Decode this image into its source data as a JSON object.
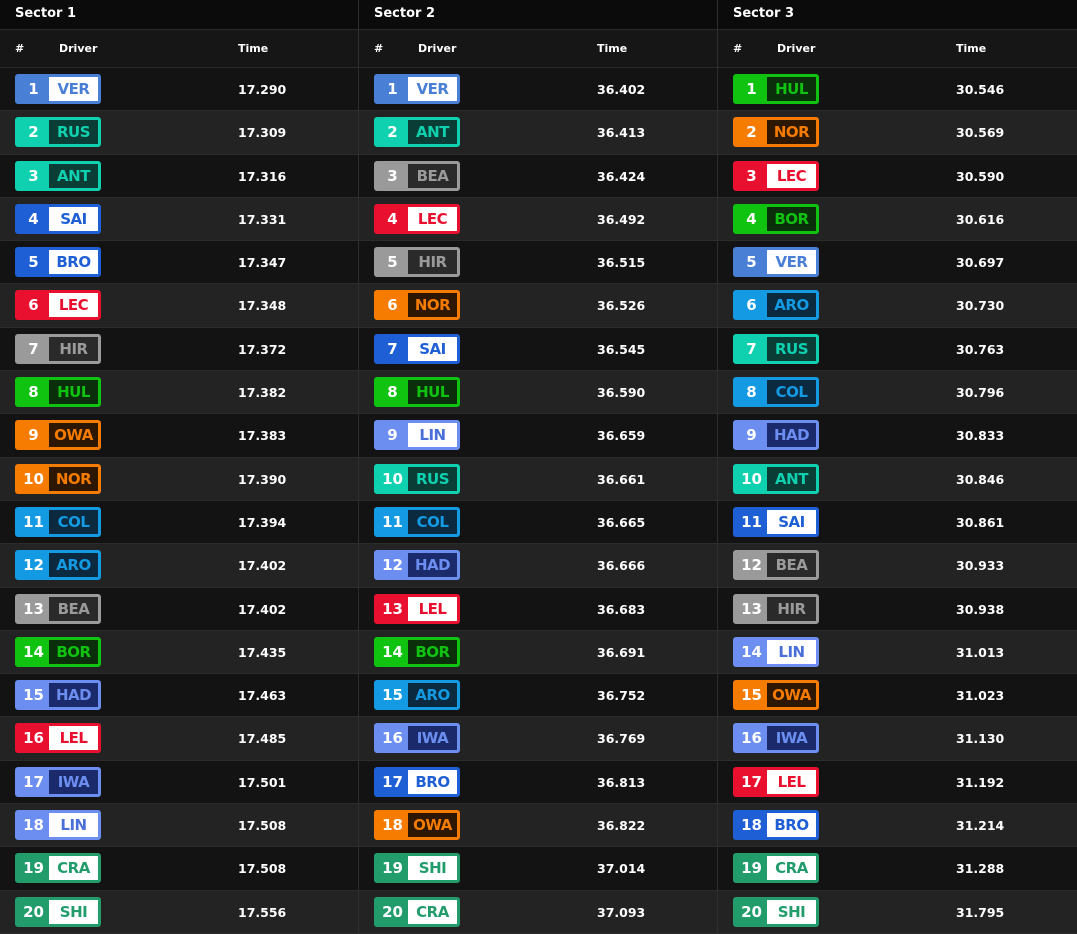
{
  "headers": {
    "num": "#",
    "driver": "Driver",
    "time": "Time"
  },
  "teams": {
    "VER": {
      "bg": "#4a7fd6",
      "inner": "#ffffff",
      "text": "#4a7fd6"
    },
    "HAD": {
      "bg": "#6b8ef0",
      "inner": "#1b2a6b",
      "text": "#6b8ef0"
    },
    "LIN": {
      "bg": "#6b8ef0",
      "inner": "#ffffff",
      "text": "#4a6fd8"
    },
    "IWA": {
      "bg": "#6b8ef0",
      "inner": "#1b2a6b",
      "text": "#6b8ef0"
    },
    "RUS": {
      "bg": "#0fd1b0",
      "inner": "#0a3d35",
      "text": "#0fd1b0"
    },
    "ANT": {
      "bg": "#0fd1b0",
      "inner": "#0a3d35",
      "text": "#0fd1b0"
    },
    "SAI": {
      "bg": "#1e5fd6",
      "inner": "#ffffff",
      "text": "#1e5fd6"
    },
    "ALB": {
      "bg": "#1e5fd6",
      "inner": "#ffffff",
      "text": "#1e5fd6"
    },
    "BRO": {
      "bg": "#1e5fd6",
      "inner": "#ffffff",
      "text": "#1e5fd6"
    },
    "LEC": {
      "bg": "#e8102e",
      "inner": "#ffffff",
      "text": "#e8102e"
    },
    "LEL": {
      "bg": "#e8102e",
      "inner": "#ffffff",
      "text": "#e8102e"
    },
    "HIR": {
      "bg": "#9a9a9a",
      "inner": "#2a2a2a",
      "text": "#9a9a9a"
    },
    "BEA": {
      "bg": "#9a9a9a",
      "inner": "#2a2a2a",
      "text": "#9a9a9a"
    },
    "HUL": {
      "bg": "#11c311",
      "inner": "#0b2e0b",
      "text": "#11c311"
    },
    "BOR": {
      "bg": "#11c311",
      "inner": "#0b2e0b",
      "text": "#11c311"
    },
    "NOR": {
      "bg": "#f57c00",
      "inner": "#2e1700",
      "text": "#f57c00"
    },
    "OWA": {
      "bg": "#f57c00",
      "inner": "#2e1700",
      "text": "#f57c00"
    },
    "COL": {
      "bg": "#149ae3",
      "inner": "#0b2a40",
      "text": "#149ae3"
    },
    "ARO": {
      "bg": "#149ae3",
      "inner": "#0b2a40",
      "text": "#149ae3"
    },
    "CRA": {
      "bg": "#239c6c",
      "inner": "#ffffff",
      "text": "#239c6c"
    },
    "SHI": {
      "bg": "#239c6c",
      "inner": "#ffffff",
      "text": "#239c6c"
    }
  },
  "sectors": [
    {
      "title": "Sector 1",
      "rows": [
        {
          "pos": "1",
          "code": "VER",
          "time": "17.290"
        },
        {
          "pos": "2",
          "code": "RUS",
          "time": "17.309"
        },
        {
          "pos": "3",
          "code": "ANT",
          "time": "17.316"
        },
        {
          "pos": "4",
          "code": "SAI",
          "time": "17.331"
        },
        {
          "pos": "5",
          "code": "BRO",
          "time": "17.347"
        },
        {
          "pos": "6",
          "code": "LEC",
          "time": "17.348"
        },
        {
          "pos": "7",
          "code": "HIR",
          "time": "17.372"
        },
        {
          "pos": "8",
          "code": "HUL",
          "time": "17.382"
        },
        {
          "pos": "9",
          "code": "OWA",
          "time": "17.383"
        },
        {
          "pos": "10",
          "code": "NOR",
          "time": "17.390"
        },
        {
          "pos": "11",
          "code": "COL",
          "time": "17.394"
        },
        {
          "pos": "12",
          "code": "ARO",
          "time": "17.402"
        },
        {
          "pos": "13",
          "code": "BEA",
          "time": "17.402"
        },
        {
          "pos": "14",
          "code": "BOR",
          "time": "17.435"
        },
        {
          "pos": "15",
          "code": "HAD",
          "time": "17.463"
        },
        {
          "pos": "16",
          "code": "LEL",
          "time": "17.485"
        },
        {
          "pos": "17",
          "code": "IWA",
          "time": "17.501"
        },
        {
          "pos": "18",
          "code": "LIN",
          "time": "17.508"
        },
        {
          "pos": "19",
          "code": "CRA",
          "time": "17.508"
        },
        {
          "pos": "20",
          "code": "SHI",
          "time": "17.556"
        }
      ]
    },
    {
      "title": "Sector 2",
      "rows": [
        {
          "pos": "1",
          "code": "VER",
          "time": "36.402"
        },
        {
          "pos": "2",
          "code": "ANT",
          "time": "36.413"
        },
        {
          "pos": "3",
          "code": "BEA",
          "time": "36.424"
        },
        {
          "pos": "4",
          "code": "LEC",
          "time": "36.492"
        },
        {
          "pos": "5",
          "code": "HIR",
          "time": "36.515"
        },
        {
          "pos": "6",
          "code": "NOR",
          "time": "36.526"
        },
        {
          "pos": "7",
          "code": "SAI",
          "time": "36.545"
        },
        {
          "pos": "8",
          "code": "HUL",
          "time": "36.590"
        },
        {
          "pos": "9",
          "code": "LIN",
          "time": "36.659"
        },
        {
          "pos": "10",
          "code": "RUS",
          "time": "36.661"
        },
        {
          "pos": "11",
          "code": "COL",
          "time": "36.665"
        },
        {
          "pos": "12",
          "code": "HAD",
          "time": "36.666"
        },
        {
          "pos": "13",
          "code": "LEL",
          "time": "36.683"
        },
        {
          "pos": "14",
          "code": "BOR",
          "time": "36.691"
        },
        {
          "pos": "15",
          "code": "ARO",
          "time": "36.752"
        },
        {
          "pos": "16",
          "code": "IWA",
          "time": "36.769"
        },
        {
          "pos": "17",
          "code": "BRO",
          "time": "36.813"
        },
        {
          "pos": "18",
          "code": "OWA",
          "time": "36.822"
        },
        {
          "pos": "19",
          "code": "SHI",
          "time": "37.014"
        },
        {
          "pos": "20",
          "code": "CRA",
          "time": "37.093"
        }
      ]
    },
    {
      "title": "Sector 3",
      "rows": [
        {
          "pos": "1",
          "code": "HUL",
          "time": "30.546"
        },
        {
          "pos": "2",
          "code": "NOR",
          "time": "30.569"
        },
        {
          "pos": "3",
          "code": "LEC",
          "time": "30.590"
        },
        {
          "pos": "4",
          "code": "BOR",
          "time": "30.616"
        },
        {
          "pos": "5",
          "code": "VER",
          "time": "30.697"
        },
        {
          "pos": "6",
          "code": "ARO",
          "time": "30.730"
        },
        {
          "pos": "7",
          "code": "RUS",
          "time": "30.763"
        },
        {
          "pos": "8",
          "code": "COL",
          "time": "30.796"
        },
        {
          "pos": "9",
          "code": "HAD",
          "time": "30.833"
        },
        {
          "pos": "10",
          "code": "ANT",
          "time": "30.846"
        },
        {
          "pos": "11",
          "code": "SAI",
          "time": "30.861"
        },
        {
          "pos": "12",
          "code": "BEA",
          "time": "30.933"
        },
        {
          "pos": "13",
          "code": "HIR",
          "time": "30.938"
        },
        {
          "pos": "14",
          "code": "LIN",
          "time": "31.013"
        },
        {
          "pos": "15",
          "code": "OWA",
          "time": "31.023"
        },
        {
          "pos": "16",
          "code": "IWA",
          "time": "31.130"
        },
        {
          "pos": "17",
          "code": "LEL",
          "time": "31.192"
        },
        {
          "pos": "18",
          "code": "BRO",
          "time": "31.214"
        },
        {
          "pos": "19",
          "code": "CRA",
          "time": "31.288"
        },
        {
          "pos": "20",
          "code": "SHI",
          "time": "31.795"
        }
      ]
    }
  ]
}
